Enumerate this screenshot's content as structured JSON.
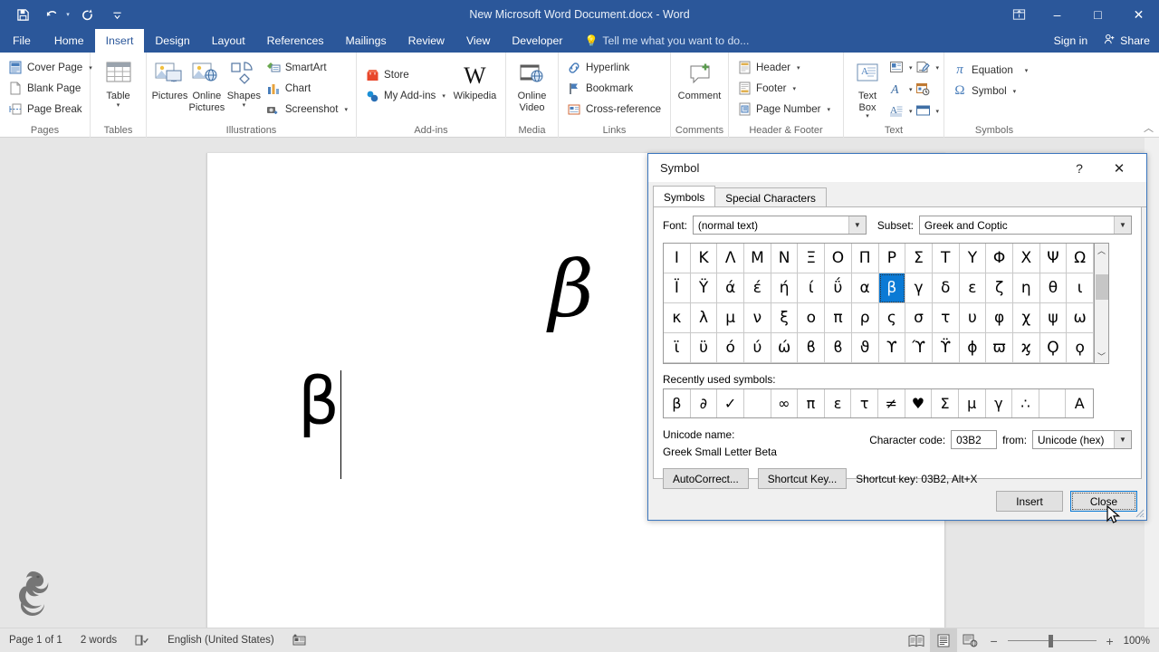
{
  "window": {
    "title": "New Microsoft Word Document.docx - Word",
    "quick_access": [
      {
        "name": "save",
        "icon": "save-icon"
      },
      {
        "name": "undo",
        "icon": "undo-icon"
      },
      {
        "name": "redo",
        "icon": "redo-icon"
      },
      {
        "name": "customize-quick-access-toolbar",
        "icon": "chevron-down-icon"
      }
    ],
    "controls": {
      "ribbon_display_options": "ribbon-display-options-icon",
      "minimize": "–",
      "maximize": "□",
      "close": "✕"
    }
  },
  "tabs": [
    {
      "label": "File",
      "active": false
    },
    {
      "label": "Home",
      "active": false
    },
    {
      "label": "Insert",
      "active": true
    },
    {
      "label": "Design",
      "active": false
    },
    {
      "label": "Layout",
      "active": false
    },
    {
      "label": "References",
      "active": false
    },
    {
      "label": "Mailings",
      "active": false
    },
    {
      "label": "Review",
      "active": false
    },
    {
      "label": "View",
      "active": false
    },
    {
      "label": "Developer",
      "active": false
    }
  ],
  "tellme": {
    "placeholder": "Tell me what you want to do..."
  },
  "account": {
    "signin": "Sign in",
    "share": "Share"
  },
  "ribbon": {
    "groups": [
      {
        "label": "Pages",
        "items": [
          {
            "label": "Cover Page",
            "dropdown": true,
            "icon": "cover-page-icon"
          },
          {
            "label": "Blank Page",
            "dropdown": false,
            "icon": "blank-page-icon"
          },
          {
            "label": "Page Break",
            "dropdown": false,
            "icon": "page-break-icon"
          }
        ]
      },
      {
        "label": "Tables",
        "items": [
          {
            "label": "Table",
            "dropdown": true,
            "icon": "table-icon"
          }
        ]
      },
      {
        "label": "Illustrations",
        "items": [
          {
            "label": "Pictures",
            "dropdown": false,
            "icon": "pictures-icon"
          },
          {
            "label": "Online\nPictures",
            "dropdown": false,
            "icon": "online-pictures-icon"
          },
          {
            "label": "Shapes",
            "dropdown": true,
            "icon": "shapes-icon"
          },
          {
            "label": "SmartArt",
            "dropdown": false,
            "icon": "smartart-icon"
          },
          {
            "label": "Chart",
            "dropdown": false,
            "icon": "chart-icon"
          },
          {
            "label": "Screenshot",
            "dropdown": true,
            "icon": "screenshot-icon"
          }
        ]
      },
      {
        "label": "Add-ins",
        "items": [
          {
            "label": "Store",
            "dropdown": false,
            "icon": "store-icon"
          },
          {
            "label": "My Add-ins",
            "dropdown": true,
            "icon": "my-addins-icon"
          },
          {
            "label": "Wikipedia",
            "dropdown": false,
            "icon": "wikipedia-icon"
          }
        ]
      },
      {
        "label": "Media",
        "items": [
          {
            "label": "Online\nVideo",
            "dropdown": false,
            "icon": "online-video-icon"
          }
        ]
      },
      {
        "label": "Links",
        "items": [
          {
            "label": "Hyperlink",
            "dropdown": false,
            "icon": "hyperlink-icon"
          },
          {
            "label": "Bookmark",
            "dropdown": false,
            "icon": "bookmark-icon"
          },
          {
            "label": "Cross-reference",
            "dropdown": false,
            "icon": "cross-reference-icon"
          }
        ]
      },
      {
        "label": "Comments",
        "items": [
          {
            "label": "Comment",
            "dropdown": false,
            "icon": "comment-icon"
          }
        ]
      },
      {
        "label": "Header & Footer",
        "items": [
          {
            "label": "Header",
            "dropdown": true,
            "icon": "header-icon"
          },
          {
            "label": "Footer",
            "dropdown": true,
            "icon": "footer-icon"
          },
          {
            "label": "Page Number",
            "dropdown": true,
            "icon": "page-number-icon"
          }
        ]
      },
      {
        "label": "Text",
        "items": [
          {
            "label": "Text\nBox",
            "dropdown": true,
            "icon": "text-box-icon"
          },
          {
            "label": "",
            "dropdown": true,
            "icon": "quick-parts-icon"
          },
          {
            "label": "",
            "dropdown": true,
            "icon": "signature-line-icon"
          },
          {
            "label": "",
            "dropdown": true,
            "icon": "wordart-icon"
          },
          {
            "label": "",
            "dropdown": false,
            "icon": "date-time-icon"
          },
          {
            "label": "",
            "dropdown": true,
            "icon": "drop-cap-icon"
          },
          {
            "label": "",
            "dropdown": true,
            "icon": "object-icon"
          }
        ]
      },
      {
        "label": "Symbols",
        "items": [
          {
            "label": "Equation",
            "dropdown": true,
            "icon": "equation-icon"
          },
          {
            "label": "Symbol",
            "dropdown": true,
            "icon": "symbol-icon"
          }
        ]
      }
    ],
    "collapse": "collapse-ribbon-icon"
  },
  "document": {
    "text_italic_beta": "β",
    "text_upright_beta": "β",
    "watermark": "dragon-logo"
  },
  "dialog": {
    "title": "Symbol",
    "help": "?",
    "close": "✕",
    "tabs": [
      {
        "label": "Symbols",
        "active": true
      },
      {
        "label": "Special Characters",
        "active": false
      }
    ],
    "font_label": "Font:",
    "font_value": "(normal text)",
    "subset_label": "Subset:",
    "subset_value": "Greek and Coptic",
    "symbol_grid": [
      "Ι",
      "Κ",
      "Λ",
      "Μ",
      "Ν",
      "Ξ",
      "Ο",
      "Π",
      "Ρ",
      "Σ",
      "Τ",
      "Υ",
      "Φ",
      "Χ",
      "Ψ",
      "Ω",
      "Ϊ",
      "Ϋ",
      "ά",
      "έ",
      "ή",
      "ί",
      "ΰ",
      "α",
      "β",
      "γ",
      "δ",
      "ε",
      "ζ",
      "η",
      "θ",
      "ι",
      "κ",
      "λ",
      "μ",
      "ν",
      "ξ",
      "ο",
      "π",
      "ρ",
      "ς",
      "σ",
      "τ",
      "υ",
      "φ",
      "χ",
      "ψ",
      "ω",
      "ϊ",
      "ϋ",
      "ό",
      "ύ",
      "ώ",
      "ϐ",
      "ϐ",
      "ϑ",
      "ϒ",
      "ϓ",
      "ϔ",
      "ϕ",
      "ϖ",
      "ϗ",
      "Ϙ",
      "ϙ"
    ],
    "selected_index": 24,
    "recent_label": "Recently used symbols:",
    "recent_symbols": [
      "β",
      "∂",
      "✓",
      "",
      "∞",
      "π",
      "ε",
      "τ",
      "≠",
      "♥",
      "Σ",
      "μ",
      "γ",
      "∴",
      "",
      "Α"
    ],
    "unicode_name_label": "Unicode name:",
    "unicode_name_value": "Greek Small Letter Beta",
    "charcode_label": "Character code:",
    "charcode_value": "03B2",
    "from_label": "from:",
    "from_value": "Unicode (hex)",
    "autocorrect_label": "AutoCorrect...",
    "shortcutkey_label": "Shortcut Key...",
    "shortcut_text": "Shortcut key: 03B2, Alt+X",
    "insert_label": "Insert",
    "close_label": "Close"
  },
  "statusbar": {
    "page": "Page 1 of 1",
    "words": "2 words",
    "proofing_icon": "proofing-errors-icon",
    "language": "English (United States)",
    "macro_icon": "macro-record-icon",
    "views": [
      {
        "name": "read-mode",
        "icon": "read-mode-icon",
        "active": false
      },
      {
        "name": "print-layout",
        "icon": "print-layout-icon",
        "active": true
      },
      {
        "name": "web-layout",
        "icon": "web-layout-icon",
        "active": false
      }
    ],
    "zoom_out": "−",
    "zoom_in": "+",
    "zoom_value": "100%"
  }
}
